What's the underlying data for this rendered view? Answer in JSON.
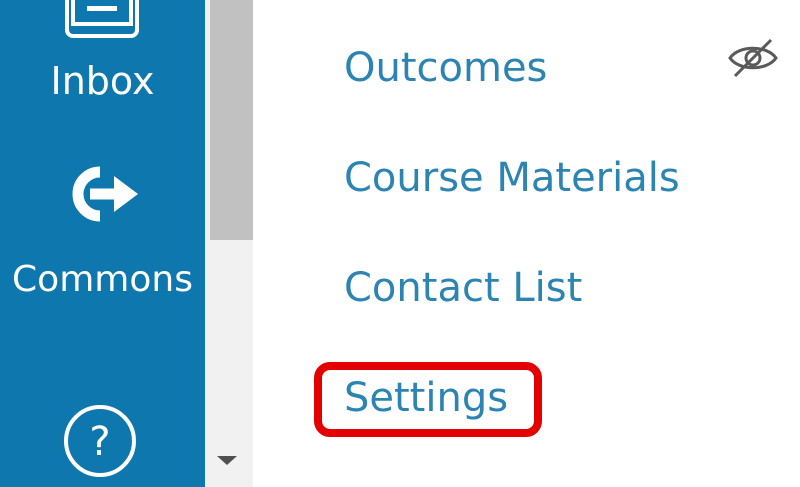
{
  "global_nav": {
    "items": [
      {
        "label": "Inbox",
        "icon": "inbox-icon"
      },
      {
        "label": "Commons",
        "icon": "commons-icon"
      },
      {
        "label": "",
        "icon": "help-icon"
      }
    ]
  },
  "course_nav": {
    "items": [
      {
        "label": "Outcomes",
        "hidden_from_students": true
      },
      {
        "label": "Course Materials",
        "hidden_from_students": false
      },
      {
        "label": "Contact List",
        "hidden_from_students": false
      },
      {
        "label": "Settings",
        "hidden_from_students": false,
        "highlighted": true
      }
    ]
  },
  "colors": {
    "global_nav_bg": "#0E77AD",
    "link": "#2C84B2",
    "highlight": "#E50000",
    "scroll_track": "#f1f1f1",
    "scroll_thumb": "#c1c1c1"
  }
}
